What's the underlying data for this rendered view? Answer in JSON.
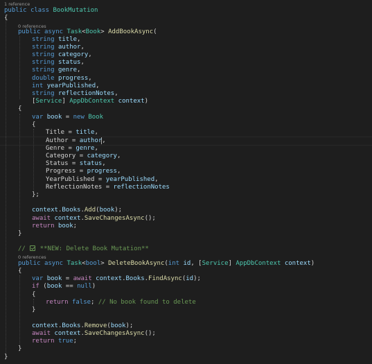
{
  "codelens": {
    "class_refs": "1 reference",
    "add_method_refs": "0 references",
    "delete_method_refs": "0 references"
  },
  "code": {
    "l01": [
      [
        "kw",
        "public "
      ],
      [
        "kw",
        "class "
      ],
      [
        "ty",
        "BookMutation"
      ]
    ],
    "l02": [
      [
        "pu",
        "{"
      ]
    ],
    "l03": [
      [
        "kw",
        "public "
      ],
      [
        "kw",
        "async "
      ],
      [
        "ty",
        "Task"
      ],
      [
        "pu",
        "<"
      ],
      [
        "ty",
        "Book"
      ],
      [
        "pu",
        "> "
      ],
      [
        "fn",
        "AddBookAsync"
      ],
      [
        "pu",
        "("
      ]
    ],
    "l04": [
      [
        "kw",
        "string "
      ],
      [
        "pa",
        "title"
      ],
      [
        "pu",
        ","
      ]
    ],
    "l05": [
      [
        "kw",
        "string "
      ],
      [
        "pa",
        "author"
      ],
      [
        "pu",
        ","
      ]
    ],
    "l06": [
      [
        "kw",
        "string "
      ],
      [
        "pa",
        "category"
      ],
      [
        "pu",
        ","
      ]
    ],
    "l07": [
      [
        "kw",
        "string "
      ],
      [
        "pa",
        "status"
      ],
      [
        "pu",
        ","
      ]
    ],
    "l08": [
      [
        "kw",
        "string "
      ],
      [
        "pa",
        "genre"
      ],
      [
        "pu",
        ","
      ]
    ],
    "l09": [
      [
        "kw",
        "double "
      ],
      [
        "pa",
        "progress"
      ],
      [
        "pu",
        ","
      ]
    ],
    "l10": [
      [
        "kw",
        "int "
      ],
      [
        "pa",
        "yearPublished"
      ],
      [
        "pu",
        ","
      ]
    ],
    "l11": [
      [
        "kw",
        "string "
      ],
      [
        "pa",
        "reflectionNotes"
      ],
      [
        "pu",
        ","
      ]
    ],
    "l12": [
      [
        "pu",
        "["
      ],
      [
        "ty",
        "Service"
      ],
      [
        "pu",
        "] "
      ],
      [
        "ty",
        "AppDbContext "
      ],
      [
        "pa",
        "context"
      ],
      [
        "pu",
        ")"
      ]
    ],
    "l13": [
      [
        "pu",
        "{"
      ]
    ],
    "l14": [
      [
        "kw",
        "var "
      ],
      [
        "pa",
        "book"
      ],
      [
        "pu",
        " = "
      ],
      [
        "kw",
        "new "
      ],
      [
        "ty",
        "Book"
      ]
    ],
    "l15": [
      [
        "pu",
        "{"
      ]
    ],
    "l16": [
      [
        "pu",
        "Title = "
      ],
      [
        "pa",
        "title"
      ],
      [
        "pu",
        ","
      ]
    ],
    "l17": [
      [
        "pu",
        "Author = "
      ],
      [
        "pa",
        "author"
      ],
      [
        "pu",
        ","
      ]
    ],
    "l18": [
      [
        "pu",
        "Genre = "
      ],
      [
        "pa",
        "genre"
      ],
      [
        "pu",
        ","
      ]
    ],
    "l19": [
      [
        "pu",
        "Category = "
      ],
      [
        "pa",
        "category"
      ],
      [
        "pu",
        ","
      ]
    ],
    "l20": [
      [
        "pu",
        "Status = "
      ],
      [
        "pa",
        "status"
      ],
      [
        "pu",
        ","
      ]
    ],
    "l21": [
      [
        "pu",
        "Progress = "
      ],
      [
        "pa",
        "progress"
      ],
      [
        "pu",
        ","
      ]
    ],
    "l22": [
      [
        "pu",
        "YearPublished = "
      ],
      [
        "pa",
        "yearPublished"
      ],
      [
        "pu",
        ","
      ]
    ],
    "l23": [
      [
        "pu",
        "ReflectionNotes = "
      ],
      [
        "pa",
        "reflectionNotes"
      ]
    ],
    "l24": [
      [
        "pu",
        "};"
      ]
    ],
    "l25": [
      [
        "pa",
        "context"
      ],
      [
        "pu",
        "."
      ],
      [
        "pa",
        "Books"
      ],
      [
        "pu",
        "."
      ],
      [
        "fn",
        "Add"
      ],
      [
        "pu",
        "("
      ],
      [
        "pa",
        "book"
      ],
      [
        "pu",
        ");"
      ]
    ],
    "l26": [
      [
        "kw2",
        "await "
      ],
      [
        "pa",
        "context"
      ],
      [
        "pu",
        "."
      ],
      [
        "fn",
        "SaveChangesAsync"
      ],
      [
        "pu",
        "();"
      ]
    ],
    "l27": [
      [
        "kw2",
        "return "
      ],
      [
        "pa",
        "book"
      ],
      [
        "pu",
        ";"
      ]
    ],
    "l28": [
      [
        "pu",
        "}"
      ]
    ],
    "l29a": [
      [
        "cm",
        "// "
      ]
    ],
    "l29b": [
      [
        "cm",
        " **NEW: Delete Book Mutation**"
      ]
    ],
    "l30": [
      [
        "kw",
        "public "
      ],
      [
        "kw",
        "async "
      ],
      [
        "ty",
        "Task"
      ],
      [
        "pu",
        "<"
      ],
      [
        "kw",
        "bool"
      ],
      [
        "pu",
        "> "
      ],
      [
        "fn",
        "DeleteBookAsync"
      ],
      [
        "pu",
        "("
      ],
      [
        "kw",
        "int "
      ],
      [
        "pa",
        "id"
      ],
      [
        "pu",
        ", ["
      ],
      [
        "ty",
        "Service"
      ],
      [
        "pu",
        "] "
      ],
      [
        "ty",
        "AppDbContext "
      ],
      [
        "pa",
        "context"
      ],
      [
        "pu",
        ")"
      ]
    ],
    "l31": [
      [
        "pu",
        "{"
      ]
    ],
    "l32": [
      [
        "kw",
        "var "
      ],
      [
        "pa",
        "book"
      ],
      [
        "pu",
        " = "
      ],
      [
        "kw2",
        "await "
      ],
      [
        "pa",
        "context"
      ],
      [
        "pu",
        "."
      ],
      [
        "pa",
        "Books"
      ],
      [
        "pu",
        "."
      ],
      [
        "fn",
        "FindAsync"
      ],
      [
        "pu",
        "("
      ],
      [
        "pa",
        "id"
      ],
      [
        "pu",
        ");"
      ]
    ],
    "l33": [
      [
        "kw2",
        "if "
      ],
      [
        "pu",
        "("
      ],
      [
        "pa",
        "book"
      ],
      [
        "pu",
        " == "
      ],
      [
        "kw",
        "null"
      ],
      [
        "pu",
        ")"
      ]
    ],
    "l34": [
      [
        "pu",
        "{"
      ]
    ],
    "l35": [
      [
        "kw2",
        "return "
      ],
      [
        "kw",
        "false"
      ],
      [
        "pu",
        "; "
      ],
      [
        "cm",
        "// No book found to delete"
      ]
    ],
    "l36": [
      [
        "pu",
        "}"
      ]
    ],
    "l37": [
      [
        "pa",
        "context"
      ],
      [
        "pu",
        "."
      ],
      [
        "pa",
        "Books"
      ],
      [
        "pu",
        "."
      ],
      [
        "fn",
        "Remove"
      ],
      [
        "pu",
        "("
      ],
      [
        "pa",
        "book"
      ],
      [
        "pu",
        ");"
      ]
    ],
    "l38": [
      [
        "kw2",
        "await "
      ],
      [
        "pa",
        "context"
      ],
      [
        "pu",
        "."
      ],
      [
        "fn",
        "SaveChangesAsync"
      ],
      [
        "pu",
        "();"
      ]
    ],
    "l39": [
      [
        "kw2",
        "return "
      ],
      [
        "kw",
        "true"
      ],
      [
        "pu",
        ";"
      ]
    ],
    "l40": [
      [
        "pu",
        "}"
      ]
    ],
    "l41": [
      [
        "pu",
        "}"
      ]
    ]
  },
  "colors": {
    "background": "#1e1e1e",
    "keyword": "#569cd6",
    "control": "#c586c0",
    "type": "#4ec9b0",
    "method": "#dcdcaa",
    "variable": "#9cdcfe",
    "comment": "#6a9955"
  },
  "icons": {
    "comment_checkbox": "checkbox-checked-icon"
  }
}
